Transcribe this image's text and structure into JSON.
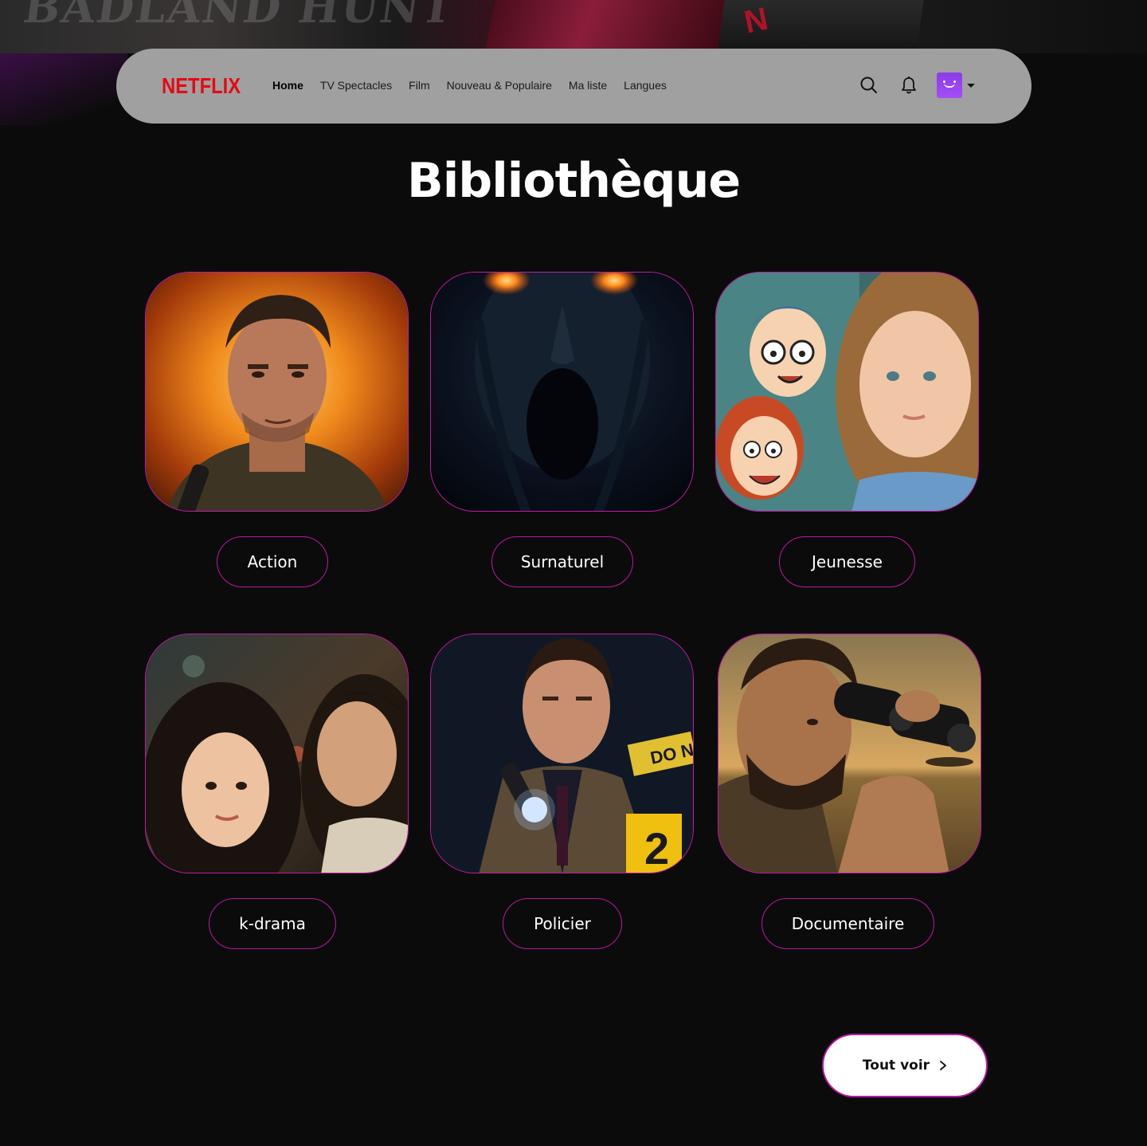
{
  "hero": {
    "ghost_text": "BADLAND HUNT"
  },
  "nav": {
    "logo": "NETFLIX",
    "links": [
      "Home",
      "TV Spectacles",
      "Film",
      "Nouveau & Populaire",
      "Ma liste",
      "Langues"
    ],
    "active_link": "Home",
    "icons": [
      "search-icon",
      "bell-icon",
      "profile-avatar",
      "caret-down-icon"
    ]
  },
  "page": {
    "title": "Bibliothèque"
  },
  "categories": [
    {
      "label": "Action",
      "image": "action-hero-explosion"
    },
    {
      "label": "Surnaturel",
      "image": "glowing-eyes-creature"
    },
    {
      "label": "Jeunesse",
      "image": "girl-and-cartoon-kids"
    },
    {
      "label": "k-drama",
      "image": "korean-couple-city-night"
    },
    {
      "label": "Policier",
      "image": "detective-flashlight"
    },
    {
      "label": "Documentaire",
      "image": "man-with-binoculars-savanna"
    }
  ],
  "actions": {
    "see_all": "Tout voir"
  },
  "colors": {
    "accent_border": "#c21aa3",
    "brand_red": "#e50914",
    "nav_bg": "#a0a0a0",
    "page_bg": "#0c0b0c"
  }
}
